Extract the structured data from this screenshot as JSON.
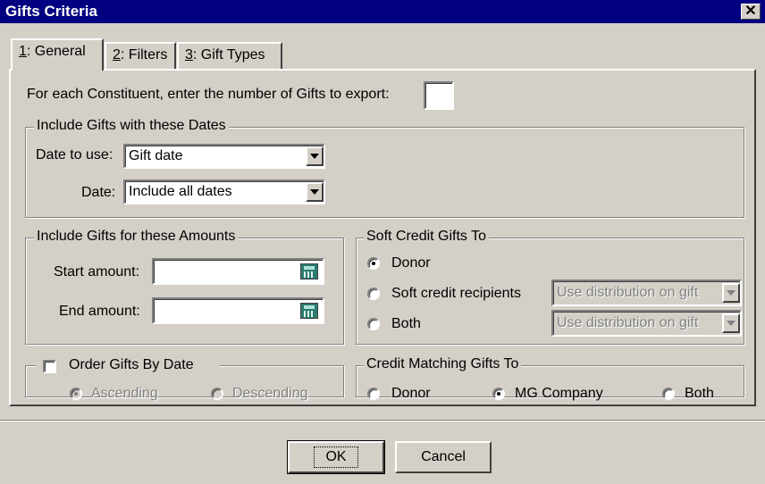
{
  "window": {
    "title": "Gifts Criteria",
    "close_glyph": "✕"
  },
  "tabs": [
    {
      "key": "1",
      "rest": ": General"
    },
    {
      "key": "2",
      "rest": ": Filters"
    },
    {
      "key": "3",
      "rest": ": Gift Types"
    }
  ],
  "general": {
    "num_gifts_label": "For each Constituent, enter the number of Gifts to export:",
    "num_gifts_value": ""
  },
  "dates": {
    "legend": "Include Gifts with these Dates",
    "date_to_use_label": "Date to use:",
    "date_to_use_value": "Gift date",
    "date_label": "Date:",
    "date_value": "Include all dates"
  },
  "amounts": {
    "legend": "Include Gifts for these Amounts",
    "start_label": "Start amount:",
    "start_value": "",
    "end_label": "End amount:",
    "end_value": ""
  },
  "soft_credit": {
    "legend": "Soft Credit Gifts To",
    "donor": "Donor",
    "recipients": "Soft credit recipients",
    "both": "Both",
    "selected": "donor",
    "recipients_dist": "Use distribution on gift",
    "both_dist": "Use distribution on gift"
  },
  "order": {
    "label": "Order Gifts By Date",
    "checked": false,
    "ascending": "Ascending",
    "descending": "Descending",
    "selected": "ascending"
  },
  "matching": {
    "legend": "Credit Matching Gifts To",
    "donor": "Donor",
    "mg_company": "MG Company",
    "both": "Both",
    "selected": "mg_company"
  },
  "buttons": {
    "ok": "OK",
    "cancel": "Cancel"
  }
}
